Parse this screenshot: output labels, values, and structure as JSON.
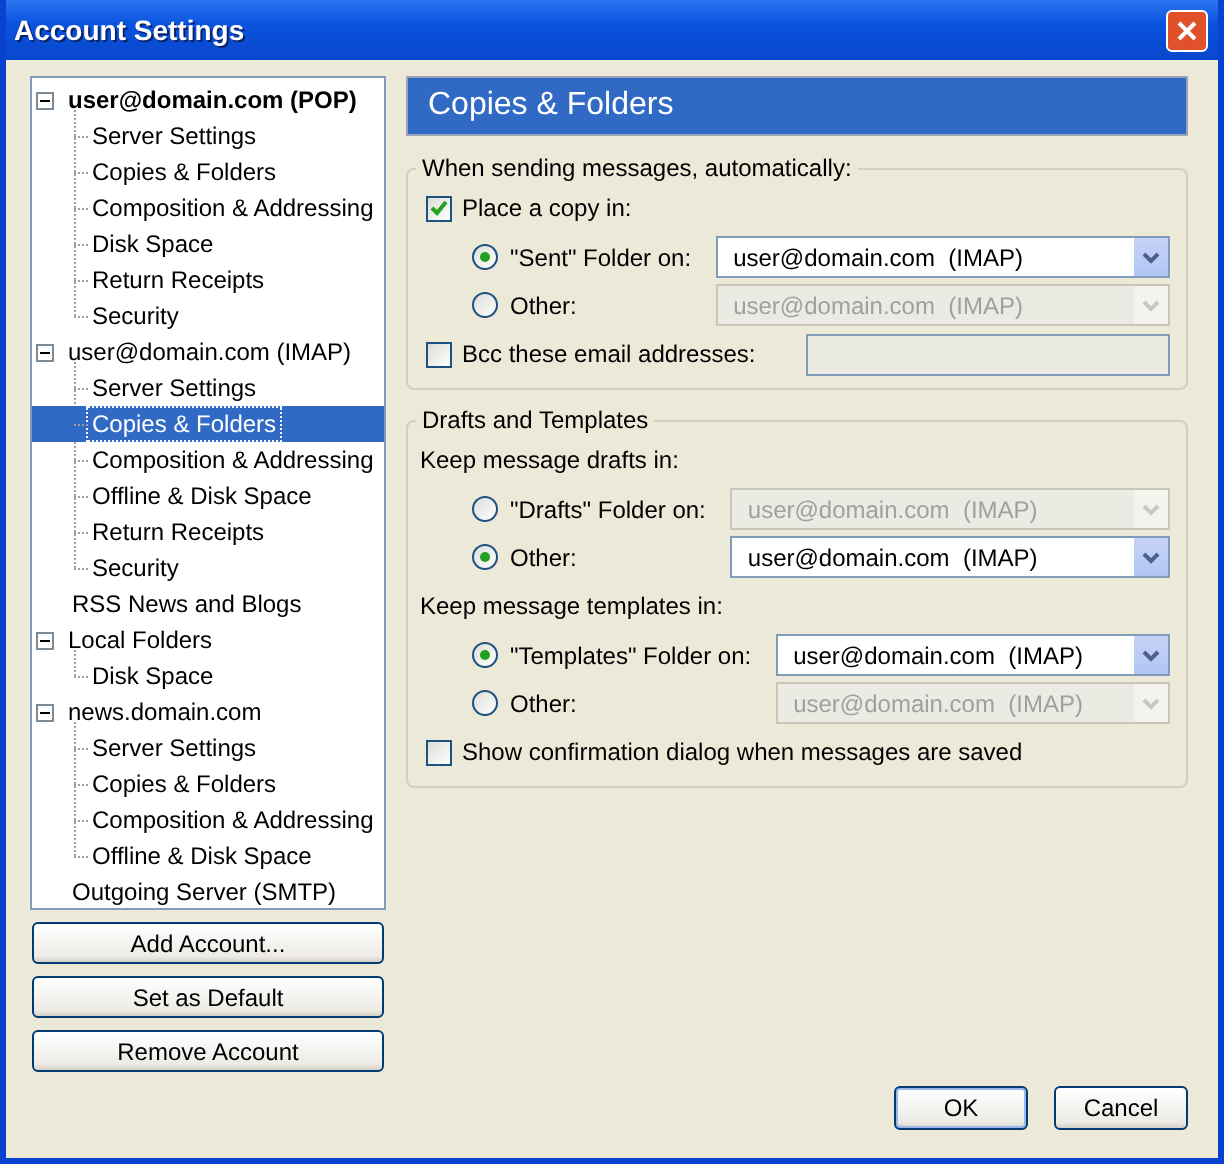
{
  "window": {
    "title": "Account Settings"
  },
  "tree": [
    {
      "label": "user@domain.com  (POP)",
      "default": true,
      "expanded": true,
      "selected": false,
      "children": [
        {
          "label": "Server Settings",
          "selected": false
        },
        {
          "label": "Copies & Folders",
          "selected": false
        },
        {
          "label": "Composition & Addressing",
          "selected": false
        },
        {
          "label": "Disk Space",
          "selected": false
        },
        {
          "label": "Return Receipts",
          "selected": false
        },
        {
          "label": "Security",
          "selected": false
        }
      ]
    },
    {
      "label": "user@domain.com  (IMAP)",
      "default": false,
      "expanded": true,
      "selected": false,
      "children": [
        {
          "label": "Server Settings",
          "selected": false
        },
        {
          "label": "Copies & Folders",
          "selected": true
        },
        {
          "label": "Composition & Addressing",
          "selected": false
        },
        {
          "label": "Offline & Disk Space",
          "selected": false
        },
        {
          "label": "Return Receipts",
          "selected": false
        },
        {
          "label": "Security",
          "selected": false
        }
      ]
    },
    {
      "label": "RSS News and Blogs",
      "default": false,
      "selected": false
    },
    {
      "label": "Local Folders",
      "default": false,
      "expanded": true,
      "selected": false,
      "children": [
        {
          "label": "Disk Space",
          "selected": false
        }
      ]
    },
    {
      "label": "news.domain.com",
      "default": false,
      "expanded": true,
      "selected": false,
      "children": [
        {
          "label": "Server Settings",
          "selected": false
        },
        {
          "label": "Copies & Folders",
          "selected": false
        },
        {
          "label": "Composition & Addressing",
          "selected": false
        },
        {
          "label": "Offline & Disk Space",
          "selected": false
        }
      ]
    },
    {
      "label": "Outgoing Server (SMTP)",
      "default": false,
      "selected": false
    }
  ],
  "account_buttons": [
    "Add Account...",
    "Set as Default",
    "Remove Account"
  ],
  "panel_title": "Copies & Folders",
  "sections": [
    {
      "legend": "When sending messages, automatically:",
      "items": [
        {
          "kind": "checkbox",
          "label": "Place a copy in:",
          "checked": true
        },
        {
          "kind": "radio-group",
          "options": [
            {
              "label": "\"Sent\" Folder on:",
              "selected": true,
              "value": "user@domain.com  (IMAP)",
              "disabled": false
            },
            {
              "label": "Other:",
              "selected": false,
              "value": "user@domain.com  (IMAP)",
              "disabled": true
            }
          ]
        },
        {
          "kind": "checkbox-field",
          "label": "Bcc these email addresses:",
          "checked": false,
          "disabled": true
        }
      ]
    },
    {
      "legend": "Drafts and Templates",
      "items": [
        {
          "kind": "label",
          "label": "Keep message drafts in:"
        },
        {
          "kind": "radio-group",
          "options": [
            {
              "label": "\"Drafts\" Folder on:",
              "selected": false,
              "value": "user@domain.com  (IMAP)",
              "disabled": true
            },
            {
              "label": "Other:",
              "selected": true,
              "value": "user@domain.com  (IMAP)",
              "disabled": false
            }
          ]
        },
        {
          "kind": "label",
          "label": "Keep message templates in:"
        },
        {
          "kind": "radio-group",
          "options": [
            {
              "label": "\"Templates\" Folder on:",
              "selected": true,
              "value": "user@domain.com  (IMAP)",
              "disabled": false
            },
            {
              "label": "Other:",
              "selected": false,
              "value": "user@domain.com  (IMAP)",
              "disabled": true
            }
          ]
        },
        {
          "kind": "checkbox",
          "label": "Show confirmation dialog when messages are saved",
          "checked": false
        }
      ]
    }
  ],
  "dialog_buttons": [
    {
      "label": "OK",
      "default": true
    },
    {
      "label": "Cancel",
      "default": false
    }
  ]
}
